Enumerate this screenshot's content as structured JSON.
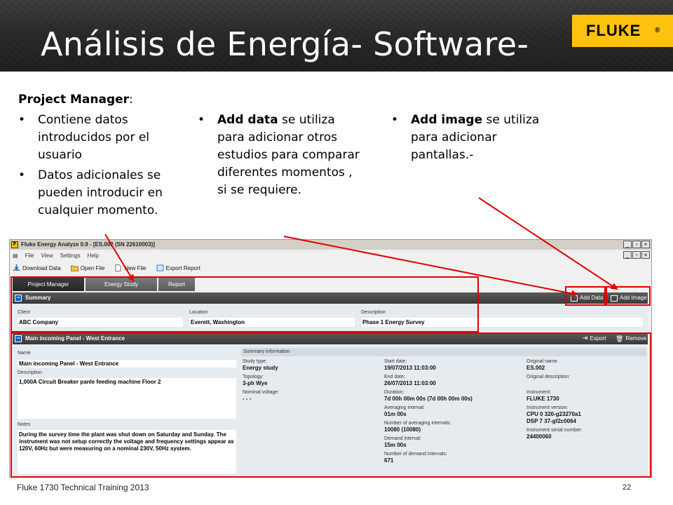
{
  "slide": {
    "title": "Análisis de Energía- Software-",
    "logo": "FLUKE",
    "logo_mark": "®",
    "footer": "Fluke 1730 Technical Training 2013",
    "page_number": "22"
  },
  "project_manager": {
    "heading": "Project Manager",
    "colon": ":",
    "bullets": [
      "Contiene datos introducidos por el usuario",
      "Datos adicionales se pueden introducir en cualquier momento."
    ]
  },
  "add_data_note": {
    "bold": "Add data",
    "rest": " se utiliza para adicionar otros estudios para comparar diferentes momentos , si se requiere."
  },
  "add_image_note": {
    "bold": "Add image",
    "rest": " se utiliza para adicionar pantallas.-"
  },
  "app": {
    "title": "Fluke Energy Analyze 0.9 - [ES.002 (SN 22610003)]",
    "menu": [
      "File",
      "View",
      "Settings",
      "Help"
    ],
    "toolbar": [
      "Download Data",
      "Open File",
      "New File",
      "Export Report"
    ],
    "tabs": [
      "Project Manager",
      "Energy Study",
      "Report"
    ],
    "summary": {
      "header": "Summary",
      "add_data": "Add Data",
      "add_image": "Add Image",
      "client_label": "Client",
      "client_value": "ABC Company",
      "location_label": "Location",
      "location_value": "Everett, Washington",
      "description_label": "Description",
      "description_value": "Phase 1 Energy Survey"
    },
    "detail": {
      "header": "Main incoming Panel - West Entrance",
      "export": "Export",
      "remove": "Remove",
      "name_label": "Name",
      "name_value": "Main incoming Panel - West Entrance",
      "description_label": "Description",
      "description_value": "1,000A Circuit Breaker panle feeding machine Floor 2",
      "notes_label": "Notes",
      "notes_value": "During the survey time the plant was shut down on Saturday and Sunday. The instrument was not setup correctly the voltage and frequency settings appear as 120V, 60Hz but were measuring on a nominal 230V, 50Hz system.",
      "summary_info": "Summary information",
      "col1": [
        {
          "label": "Study type:",
          "value": "Energy study"
        },
        {
          "label": "Topology:",
          "value": "3-ph Wye"
        },
        {
          "label": "Nominal voltage:",
          "value": "- - -"
        }
      ],
      "col2": [
        {
          "label": "Start date:",
          "value": "19/07/2013 11:03:00"
        },
        {
          "label": "End date:",
          "value": "26/07/2013 11:03:00"
        },
        {
          "label": "Duration:",
          "value": "7d 00h 00m 00s (7d 00h 00m 00s)"
        },
        {
          "label": "Averaging interval:",
          "value": "01m 00s"
        },
        {
          "label": "Number of averaging intervals:",
          "value": "10080 (10080)"
        },
        {
          "label": "Demand interval:",
          "value": "15m 00s"
        },
        {
          "label": "Number of demand intervals:",
          "value": "671"
        }
      ],
      "col3": [
        {
          "label": "Original name:",
          "value": "ES.002"
        },
        {
          "label": "Original description:",
          "value": ""
        },
        {
          "label": "Instrument:",
          "value": "FLUKE 1730"
        },
        {
          "label": "Instrument version:",
          "value": "CPU  0 320-g23270a1"
        },
        {
          "label": "",
          "value": "DSP  7 37-gf2c0064"
        },
        {
          "label": "Instrument serial number:",
          "value": "24400060"
        }
      ]
    }
  }
}
